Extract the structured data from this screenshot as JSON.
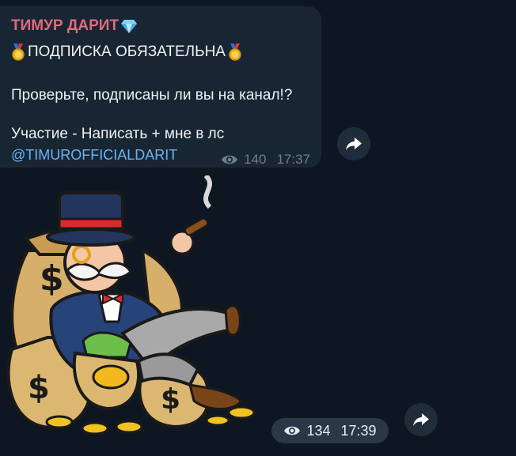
{
  "message": {
    "author": "ТИМУР ДАРИТ",
    "author_emoji": "diamond-icon",
    "line1": "ПОДПИСКА ОБЯЗАТЕЛЬНА",
    "medal_icon": "medal-icon",
    "line2": "Проверьте, подписаны ли вы на канал!?",
    "line3": "Участие - Написать + мне в лс",
    "link": "@TIMUROFFICIALDARIT",
    "views": "140",
    "time": "17:37"
  },
  "sticker_message": {
    "sticker": "money-tycoon-sticker",
    "views": "134",
    "time": "17:39"
  },
  "colors": {
    "background": "#0e1621",
    "bubble": "#182533",
    "author": "#e06b7c",
    "link": "#6ab3f3",
    "meta": "#6d7f8f"
  }
}
